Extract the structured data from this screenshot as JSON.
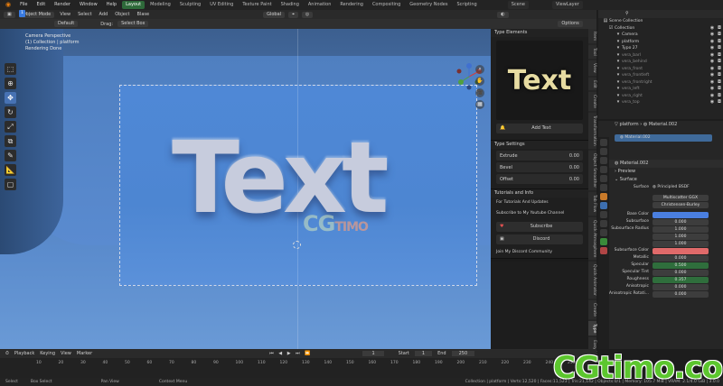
{
  "menu": [
    "File",
    "Edit",
    "Render",
    "Window",
    "Help"
  ],
  "workspaces": [
    {
      "label": "Layout",
      "active": true
    },
    {
      "label": "Modeling",
      "active": false
    },
    {
      "label": "Sculpting",
      "active": false
    },
    {
      "label": "UV Editing",
      "active": false
    },
    {
      "label": "Texture Paint",
      "active": false
    },
    {
      "label": "Shading",
      "active": false
    },
    {
      "label": "Animation",
      "active": false
    },
    {
      "label": "Rendering",
      "active": false
    },
    {
      "label": "Compositing",
      "active": false
    },
    {
      "label": "Geometry Nodes",
      "active": false
    },
    {
      "label": "Scripting",
      "active": false
    }
  ],
  "scene": {
    "name": "Scene",
    "view_layer": "ViewLayer"
  },
  "viewport_header": {
    "mode": "Object Mode",
    "menus": [
      "View",
      "Select",
      "Add",
      "Object",
      "Blase"
    ],
    "orientation": "Global",
    "options": "Options"
  },
  "tool_header": {
    "orientation_label": "Default",
    "drag_label": "Drag:",
    "select_mode": "Select Box"
  },
  "viewport_info": {
    "line1": "Camera Perspective",
    "line2": "(1) Collection | platform",
    "line3": "Rendering Done"
  },
  "viewport_text": "Text",
  "viewport_watermark": {
    "cg": "CG",
    "timo": "TIMO"
  },
  "npanel": {
    "type_elements": {
      "header": "Type Elements",
      "preview_text": "Text",
      "add_button": "Add Text"
    },
    "type_settings": {
      "header": "Type Settings",
      "fields": [
        {
          "label": "Extrude",
          "value": "0.00"
        },
        {
          "label": "Bevel",
          "value": "0.00"
        },
        {
          "label": "Offset",
          "value": "0.00"
        }
      ]
    },
    "tutorials": {
      "header": "Tutorials and Info",
      "line1": "For Tutorials And Updates",
      "line2": "Subscribe to My Youtube Channel",
      "subscribe": "Subscribe",
      "discord": "Discord",
      "community": "Join My Discord Community"
    }
  },
  "side_tabs": [
    "Item",
    "Tool",
    "View",
    "Edit",
    "Create",
    "Transformation",
    "Object Smoother",
    "Tab Flow",
    "Quick Atmosphere",
    "Quick Animator",
    "Create",
    "Type",
    "Easy Light"
  ],
  "outliner": {
    "root": "Scene Collection",
    "collection": "Collection",
    "items": [
      {
        "name": "Camera",
        "dim": false
      },
      {
        "name": "platform",
        "dim": false
      },
      {
        "name": "Typo 27",
        "dim": false
      },
      {
        "name": "vera_barl",
        "dim": true
      },
      {
        "name": "vera_behind",
        "dim": true
      },
      {
        "name": "vera_front",
        "dim": true
      },
      {
        "name": "vera_frontleft",
        "dim": true
      },
      {
        "name": "vera_frontright",
        "dim": true
      },
      {
        "name": "vera_left",
        "dim": true
      },
      {
        "name": "vera_right",
        "dim": true
      },
      {
        "name": "vera_top",
        "dim": true
      }
    ]
  },
  "properties": {
    "object": "platform",
    "material_crumb": "Material.002",
    "slot": "Material.002",
    "material_name": "Material.002",
    "preview": "Preview",
    "surface_section": "Surface",
    "surface_label": "Surface",
    "shader": "Principled BSDF",
    "distribution": "Multiscatter GGX",
    "subsurface_method": "Christensen-Burley",
    "fields": [
      {
        "label": "Base Color",
        "value": "",
        "color": "#4a7fe0"
      },
      {
        "label": "Subsurface",
        "value": "0.000"
      },
      {
        "label": "Subsurface Radius",
        "value": "1.000"
      },
      {
        "label": "",
        "value": "1.000"
      },
      {
        "label": "",
        "value": "1.000"
      },
      {
        "label": "Subsurface Color",
        "value": "",
        "color": "#e06a6a"
      },
      {
        "label": "Metallic",
        "value": "0.000"
      },
      {
        "label": "Specular",
        "value": "0.500",
        "color": "#2f6e3c"
      },
      {
        "label": "Specular Tint",
        "value": "0.000"
      },
      {
        "label": "Roughness",
        "value": "0.357",
        "color": "#2f6e3c"
      },
      {
        "label": "Anisotropic",
        "value": "0.000"
      },
      {
        "label": "Anisotropic Rotati...",
        "value": "0.000"
      }
    ]
  },
  "timeline": {
    "menus": [
      "Playback",
      "Keying",
      "View",
      "Marker"
    ],
    "current_frame": "1",
    "start_label": "Start",
    "start": "1",
    "end_label": "End",
    "end": "250",
    "ticks": [
      "10",
      "20",
      "30",
      "40",
      "50",
      "60",
      "70",
      "80",
      "90",
      "100",
      "110",
      "120",
      "130",
      "140",
      "150",
      "160",
      "170",
      "180",
      "190",
      "200",
      "210",
      "220",
      "230",
      "240",
      "250"
    ]
  },
  "statusbar": {
    "items": [
      "Select",
      "Box Select",
      "Pan View",
      "Context Menu"
    ],
    "stats": "Collection | platform | Verts:12,520 | Faces:11,523 | Tris:21,142 | Objects:0/1 | Memory: 105.7 MiB | VRAM: 2.1/4.0 GiB | 3.0.0"
  },
  "watermark": "CGtimo.com",
  "colors": {
    "accent": "#4772b3",
    "workspace_active": "#2e6a3a",
    "base_color": "#4a7fe0",
    "subsurface_color": "#e06a6a",
    "watermark": "#5cc62e"
  }
}
